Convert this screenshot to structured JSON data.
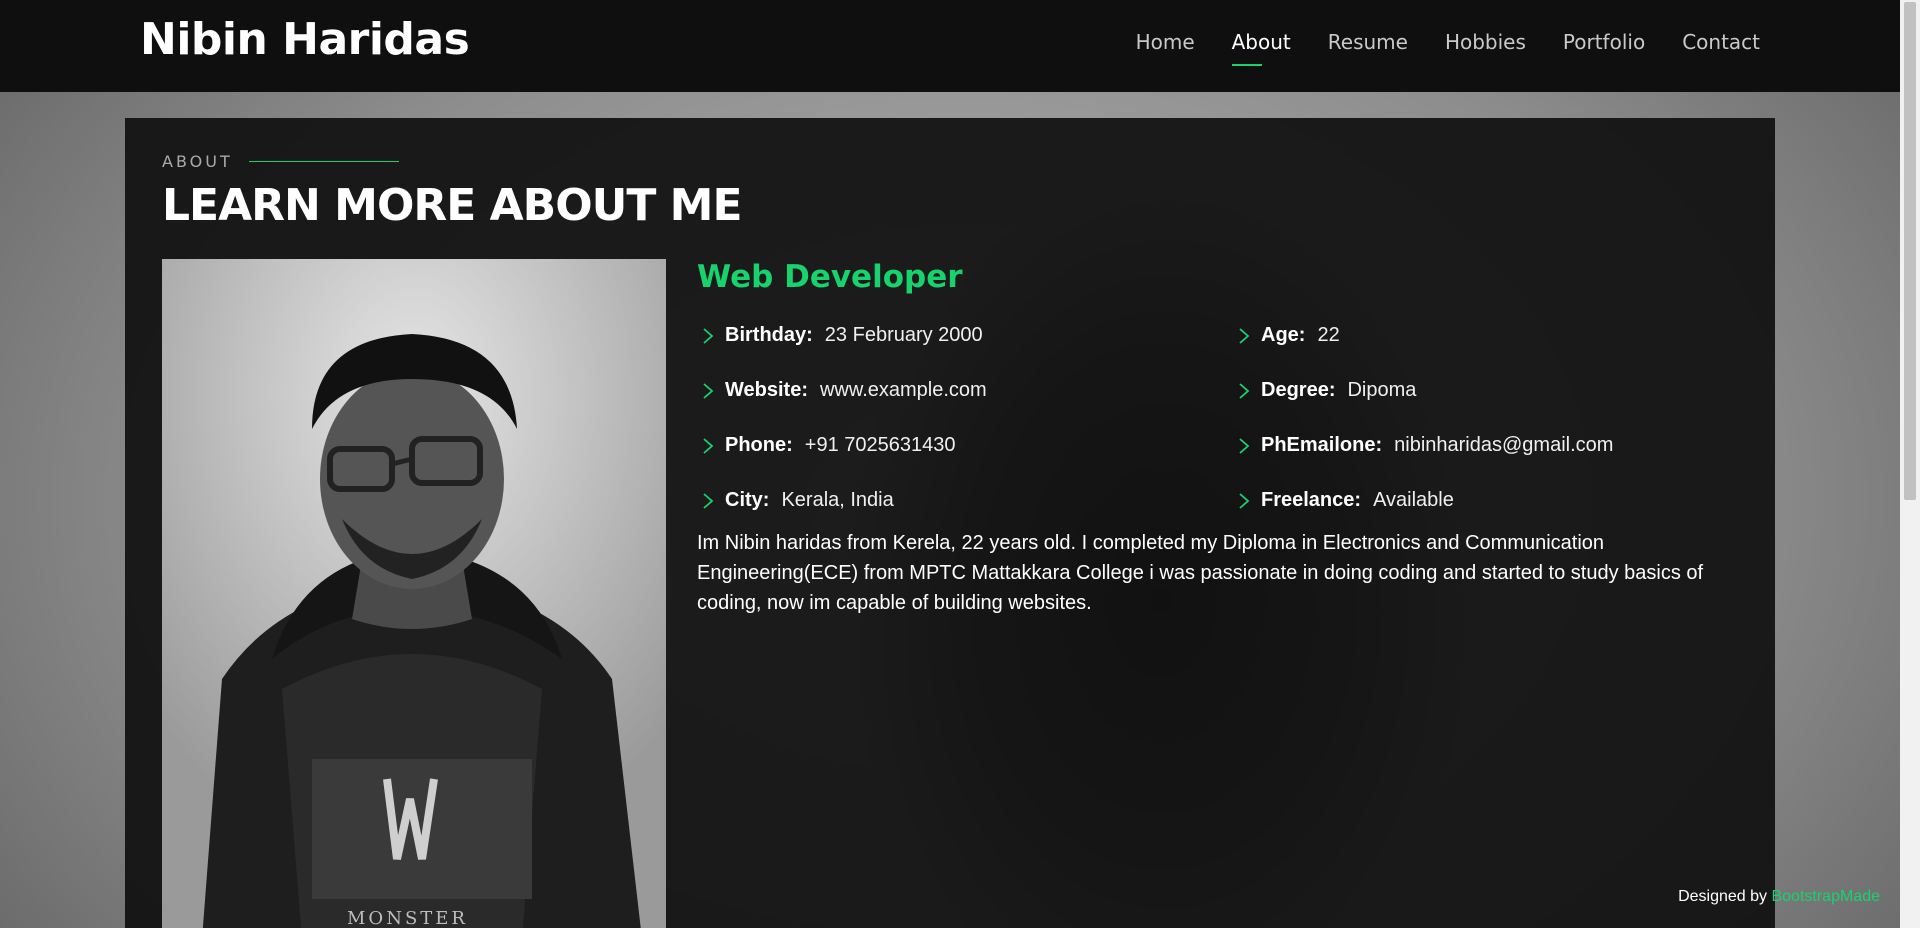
{
  "header": {
    "logo": "Nibin Haridas",
    "nav": [
      {
        "label": "Home"
      },
      {
        "label": "About"
      },
      {
        "label": "Resume"
      },
      {
        "label": "Hobbies"
      },
      {
        "label": "Portfolio"
      },
      {
        "label": "Contact"
      }
    ],
    "active": "About"
  },
  "about": {
    "label": "ABOUT",
    "title": "LEARN MORE ABOUT ME",
    "role": "Web Developer",
    "left": [
      {
        "key": "Birthday:",
        "value": "23 February 2000"
      },
      {
        "key": "Website:",
        "value": "www.example.com"
      },
      {
        "key": "Phone:",
        "value": "+91 7025631430"
      },
      {
        "key": "City:",
        "value": "Kerala, India"
      }
    ],
    "right": [
      {
        "key": "Age:",
        "value": "22"
      },
      {
        "key": "Degree:",
        "value": "Dipoma"
      },
      {
        "key": "PhEmailone:",
        "value": "nibinharidas@gmail.com"
      },
      {
        "key": "Freelance:",
        "value": "Available"
      }
    ],
    "bio": "Im Nibin haridas from Kerela, 22 years old. I completed my Diploma in Electronics and Communication Engineering(ECE) from MPTC Mattakkara College i was passionate in doing coding and started to study basics of coding, now im capable of building websites."
  },
  "credits": {
    "prefix": "Designed by ",
    "link": "BootstrapMade"
  },
  "colors": {
    "accent": "#18d26e",
    "header_bg": "#0f0f0f",
    "card_bg": "#101010"
  }
}
